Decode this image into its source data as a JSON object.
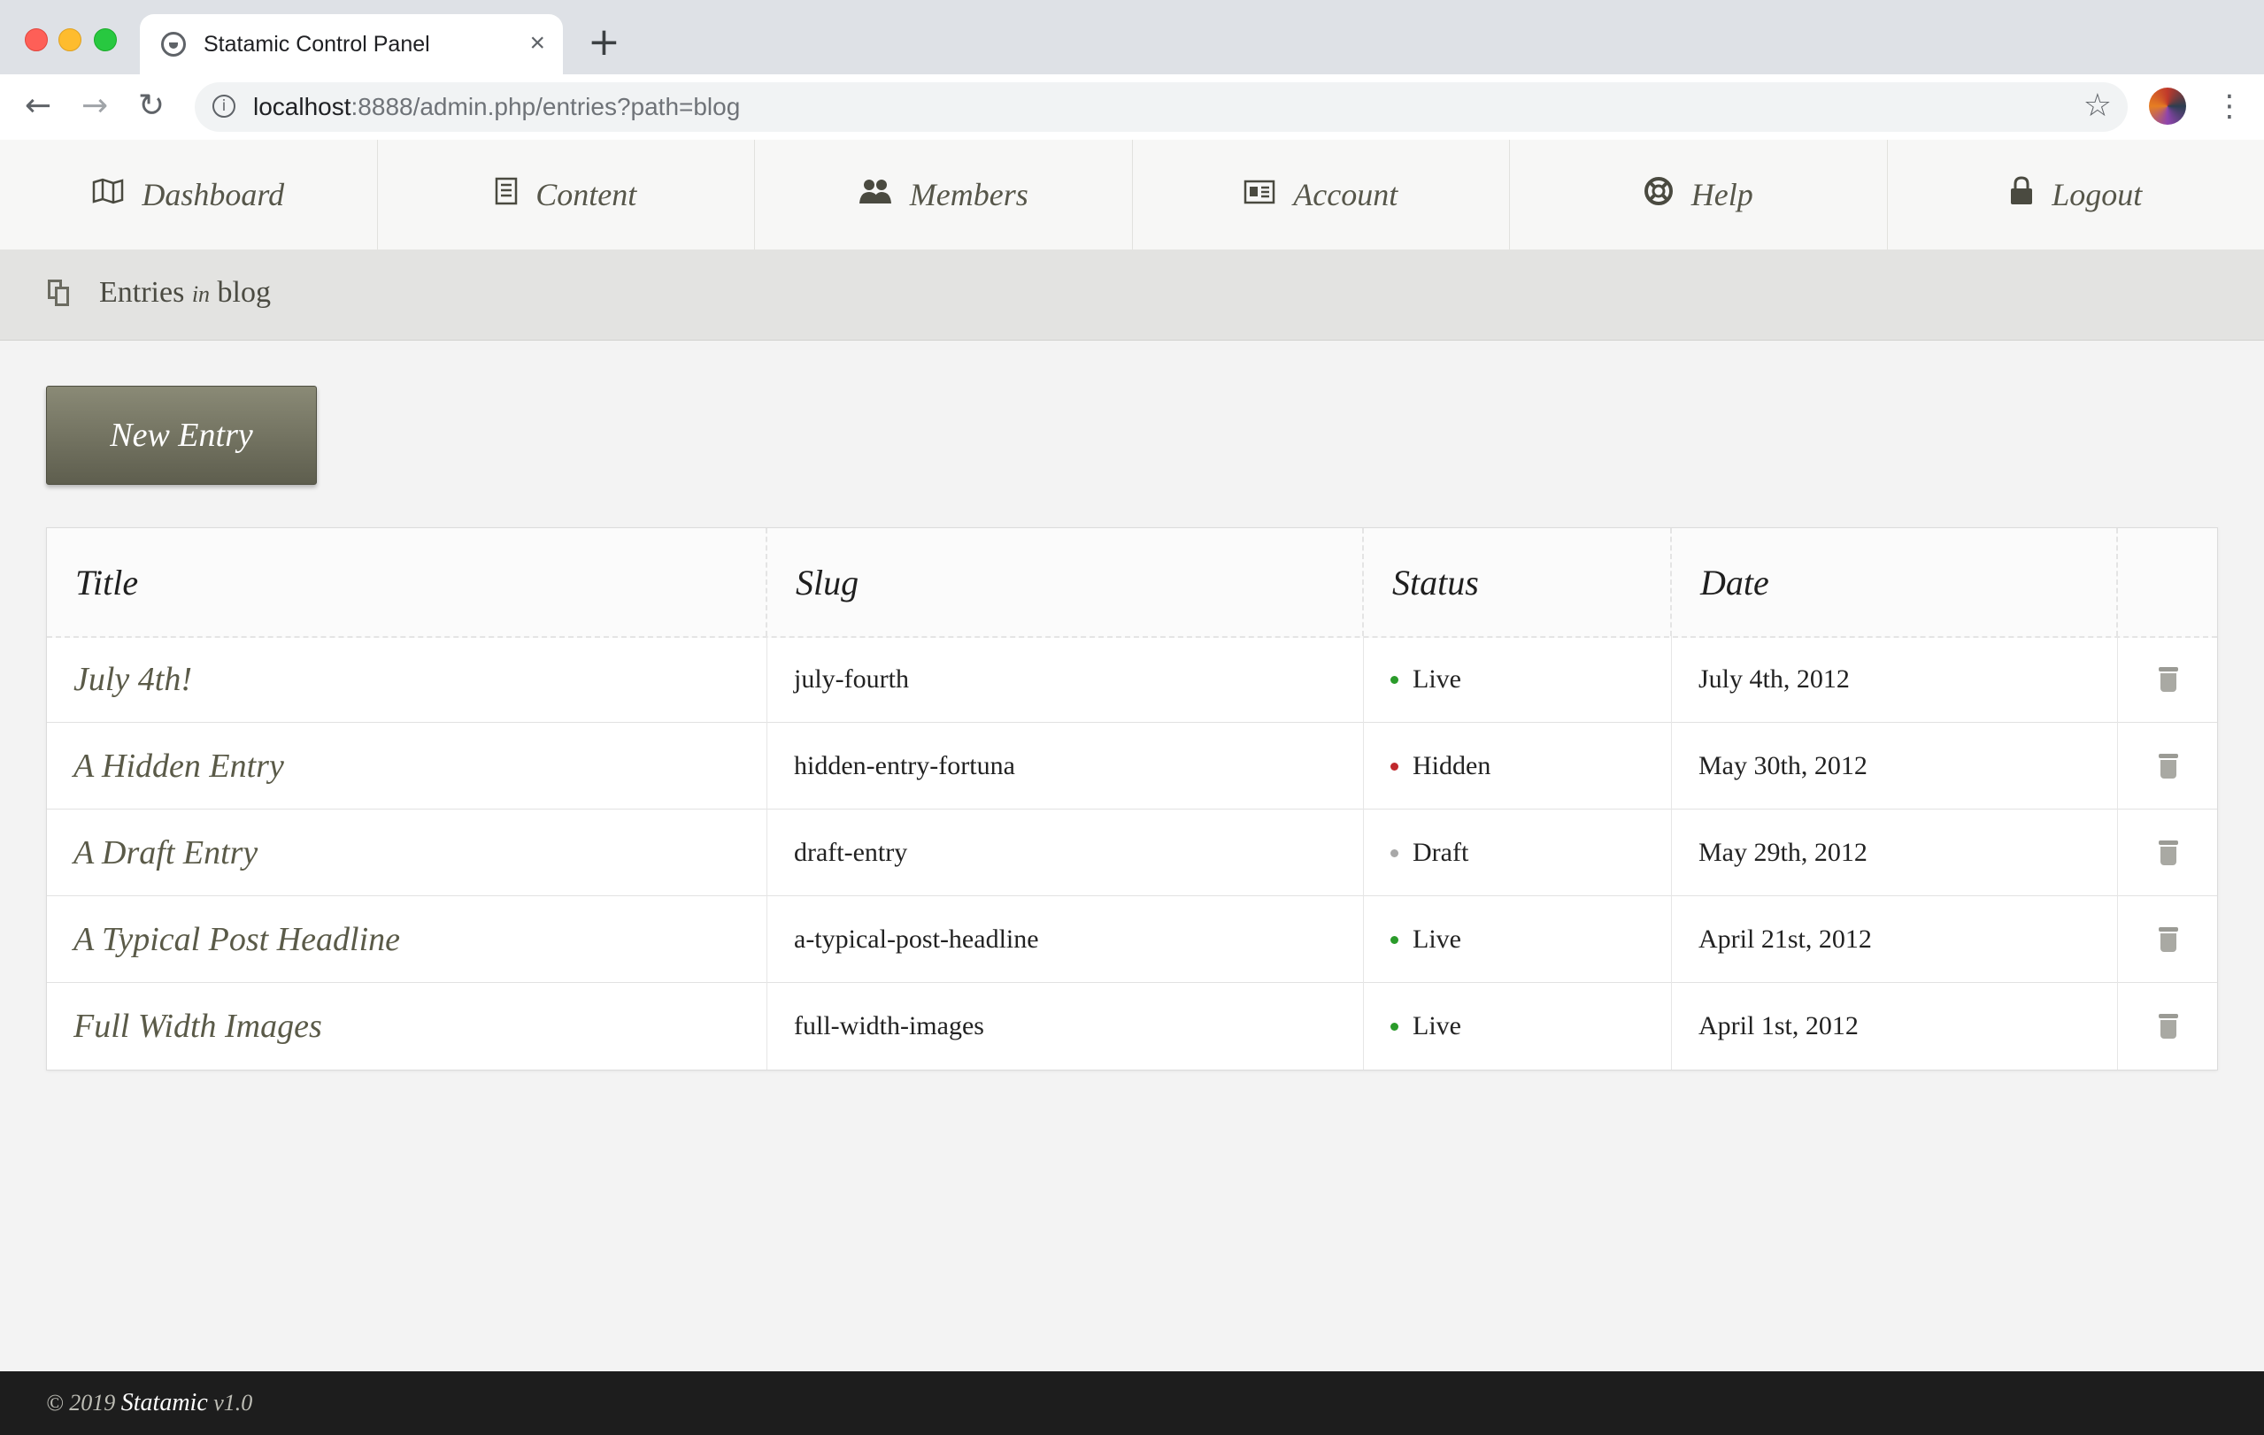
{
  "browser": {
    "tab_title": "Statamic Control Panel",
    "tab_close": "×",
    "new_tab": "+",
    "url_host": "localhost",
    "url_path": ":8888/admin.php/entries?path=blog",
    "icons": [
      "favicon-icon",
      "back-icon",
      "forward-icon",
      "reload-icon",
      "info-icon",
      "star-icon",
      "avatar",
      "more-icon"
    ]
  },
  "nav": {
    "items": [
      {
        "label": "Dashboard",
        "icon": "map-icon"
      },
      {
        "label": "Content",
        "icon": "document-icon"
      },
      {
        "label": "Members",
        "icon": "users-icon"
      },
      {
        "label": "Account",
        "icon": "id-card-icon"
      },
      {
        "label": "Help",
        "icon": "lifebuoy-icon"
      },
      {
        "label": "Logout",
        "icon": "lock-icon"
      }
    ]
  },
  "subheader": {
    "title_prefix": "Entries",
    "title_in": "in",
    "title_collection": "blog"
  },
  "actions": {
    "new_entry": "New Entry"
  },
  "table": {
    "headers": [
      "Title",
      "Slug",
      "Status",
      "Date",
      ""
    ],
    "rows": [
      {
        "title": "July 4th!",
        "slug": "july-fourth",
        "status": "Live",
        "status_color": "#2a9b2a",
        "date": "July 4th, 2012"
      },
      {
        "title": "A Hidden Entry",
        "slug": "hidden-entry-fortuna",
        "status": "Hidden",
        "status_color": "#c0282d",
        "date": "May 30th, 2012"
      },
      {
        "title": "A Draft Entry",
        "slug": "draft-entry",
        "status": "Draft",
        "status_color": "#a8a8a8",
        "date": "May 29th, 2012"
      },
      {
        "title": "A Typical Post Headline",
        "slug": "a-typical-post-headline",
        "status": "Live",
        "status_color": "#2a9b2a",
        "date": "April 21st, 2012"
      },
      {
        "title": "Full Width Images",
        "slug": "full-width-images",
        "status": "Live",
        "status_color": "#2a9b2a",
        "date": "April 1st, 2012"
      }
    ]
  },
  "footer": {
    "copyright": "© 2019",
    "brand": "Statamic",
    "version": "v1.0"
  },
  "colors": {
    "accent_button": "#6f6f5d",
    "footer_bg": "#1d1d1d"
  }
}
